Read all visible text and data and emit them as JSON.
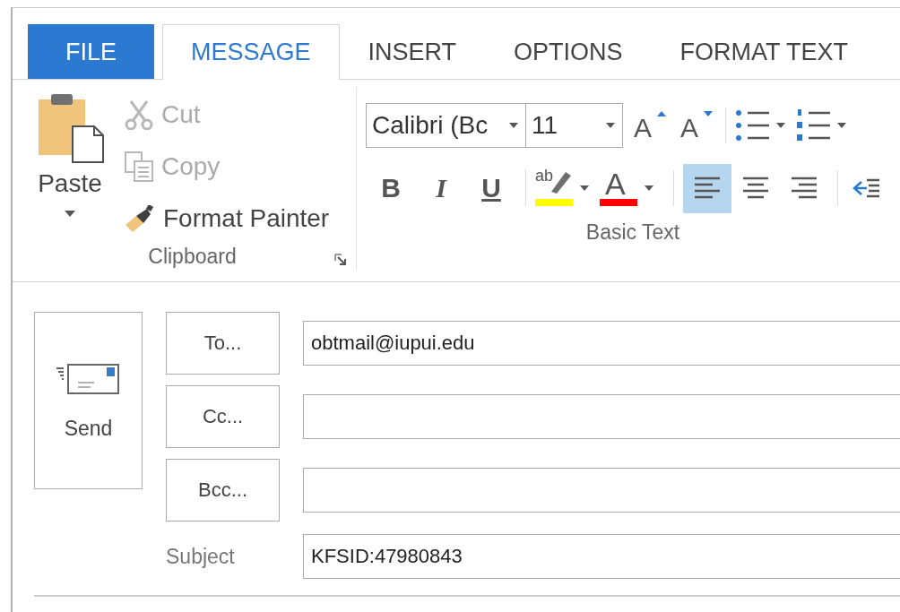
{
  "tabs": [
    {
      "label": "FILE",
      "kind": "file",
      "selected": false
    },
    {
      "label": "MESSAGE",
      "kind": "tab",
      "selected": true
    },
    {
      "label": "INSERT",
      "kind": "tab",
      "selected": false
    },
    {
      "label": "OPTIONS",
      "kind": "tab",
      "selected": false
    },
    {
      "label": "FORMAT TEXT",
      "kind": "tab",
      "selected": false
    }
  ],
  "clipboard": {
    "label": "Clipboard",
    "paste": "Paste",
    "items": [
      {
        "label": "Cut",
        "kind": "cut",
        "disabled": true
      },
      {
        "label": "Copy",
        "kind": "copy",
        "disabled": true
      },
      {
        "label": "Format Painter",
        "kind": "painter",
        "disabled": false
      }
    ]
  },
  "basic_text": {
    "label": "Basic Text",
    "font": "Calibri (Bc",
    "size": "11",
    "size_buttons": [
      {
        "glyph": "A",
        "kind": "grow"
      },
      {
        "glyph": "A",
        "kind": "shrink"
      }
    ],
    "style_buttons": [
      {
        "glyph": "B",
        "kind": "bold"
      },
      {
        "glyph": "I",
        "kind": "italic"
      },
      {
        "glyph": "U",
        "kind": "underline"
      }
    ],
    "highlight": {
      "glyph": "ab",
      "color": "#ffff00"
    },
    "font_color": {
      "glyph": "A",
      "color": "#ff0000"
    },
    "alignment": [
      {
        "kind": "left",
        "selected": true
      },
      {
        "kind": "center",
        "selected": false
      },
      {
        "kind": "right",
        "selected": false
      }
    ]
  },
  "compose": {
    "send": "Send",
    "recipients": [
      {
        "button": "To...",
        "value": "obtmail@iupui.edu"
      },
      {
        "button": "Cc..."
      },
      {
        "button": "Bcc..."
      }
    ],
    "subject": {
      "label": "Subject",
      "value": "KFSID:47980843"
    }
  }
}
